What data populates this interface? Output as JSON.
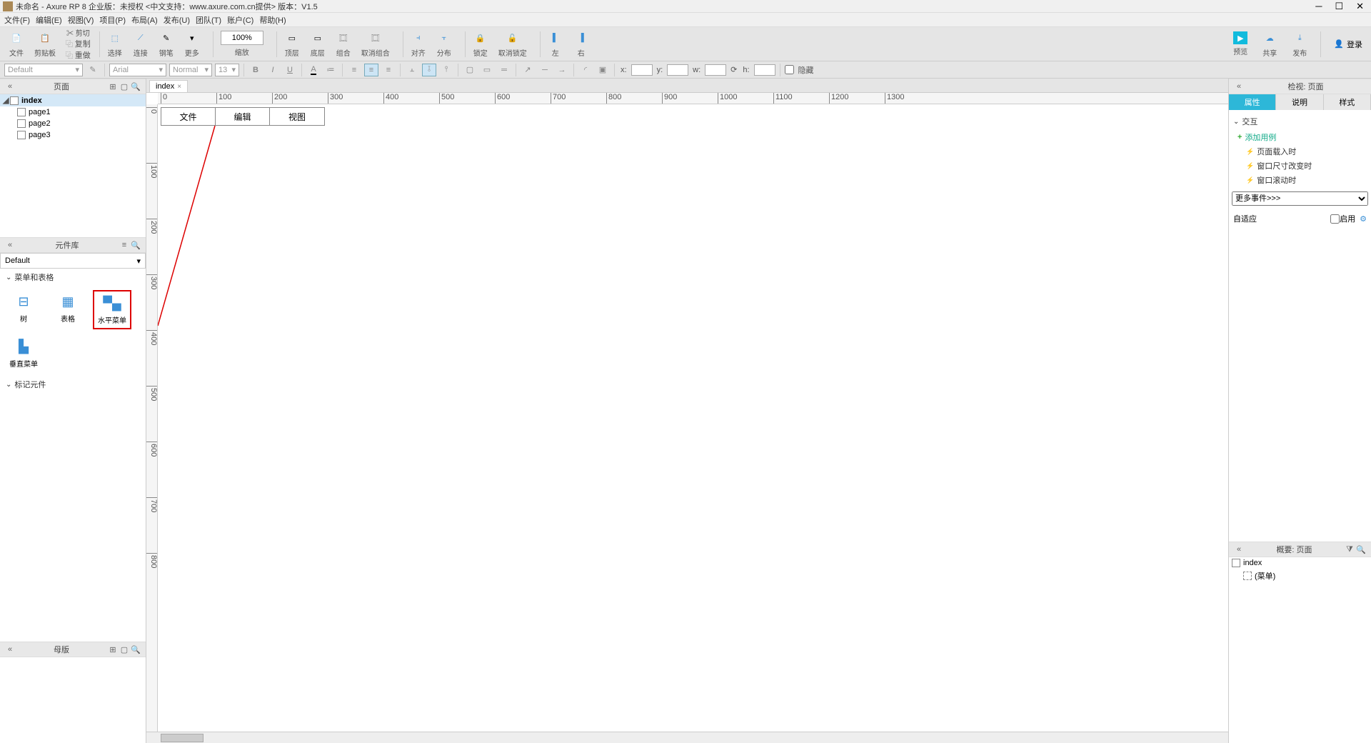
{
  "title": "未命名 - Axure RP 8 企业版：未授权     <中文支持：www.axure.com.cn提供>  版本：V1.5",
  "menus": [
    "文件(F)",
    "编辑(E)",
    "视图(V)",
    "项目(P)",
    "布局(A)",
    "发布(U)",
    "团队(T)",
    "账户(C)",
    "帮助(H)"
  ],
  "toolbar": {
    "cut": "文件",
    "paste": "剪贴板",
    "copy": "复制",
    "dup": "重做",
    "select": "选择",
    "connect": "连接",
    "pen": "钢笔",
    "more": "更多",
    "zoom": "100%",
    "zoomlbl": "缩放",
    "top": "顶层",
    "bottom": "底层",
    "group": "组合",
    "ungroup": "取消组合",
    "align": "对齐",
    "distribute": "分布",
    "lock": "锁定",
    "unlockloc": "取消锁定",
    "left": "左",
    "right": "右",
    "preview": "预览",
    "share": "共享",
    "publish": "发布",
    "login": "登录"
  },
  "prop": {
    "style": "Default",
    "font": "Arial",
    "weight": "Normal",
    "size": "13",
    "x": "x:",
    "y": "y:",
    "w": "w:",
    "h": "h:",
    "hidden": "隐藏"
  },
  "panels": {
    "pages": "页面",
    "lib": "元件库",
    "masters": "母版",
    "inspectHead": "检视: 页面",
    "outline": "概要: 页面"
  },
  "pages": {
    "root": "index",
    "children": [
      "page1",
      "page2",
      "page3"
    ]
  },
  "lib": {
    "default": "Default",
    "cat_menu": "菜单和表格",
    "cat_mark": "标记元件",
    "items_menu": [
      "树",
      "表格",
      "水平菜单",
      "垂直菜单"
    ]
  },
  "tab": "index",
  "canvas_menu": [
    "文件",
    "编辑",
    "视图"
  ],
  "inspector": {
    "tabs": [
      "属性",
      "说明",
      "样式"
    ],
    "sec_interaction": "交互",
    "add_case": "添加用例",
    "events": [
      "页面载入时",
      "窗口尺寸改变时",
      "窗口滚动时"
    ],
    "more": "更多事件>>>",
    "adaptive": "自适应",
    "enable": "启用"
  },
  "outline_items": {
    "root": "index",
    "child": "(菜单)"
  },
  "ruler_ticks": [
    0,
    100,
    200,
    300,
    400,
    500,
    600,
    700,
    800,
    900,
    1000,
    1100,
    1200,
    1300
  ]
}
